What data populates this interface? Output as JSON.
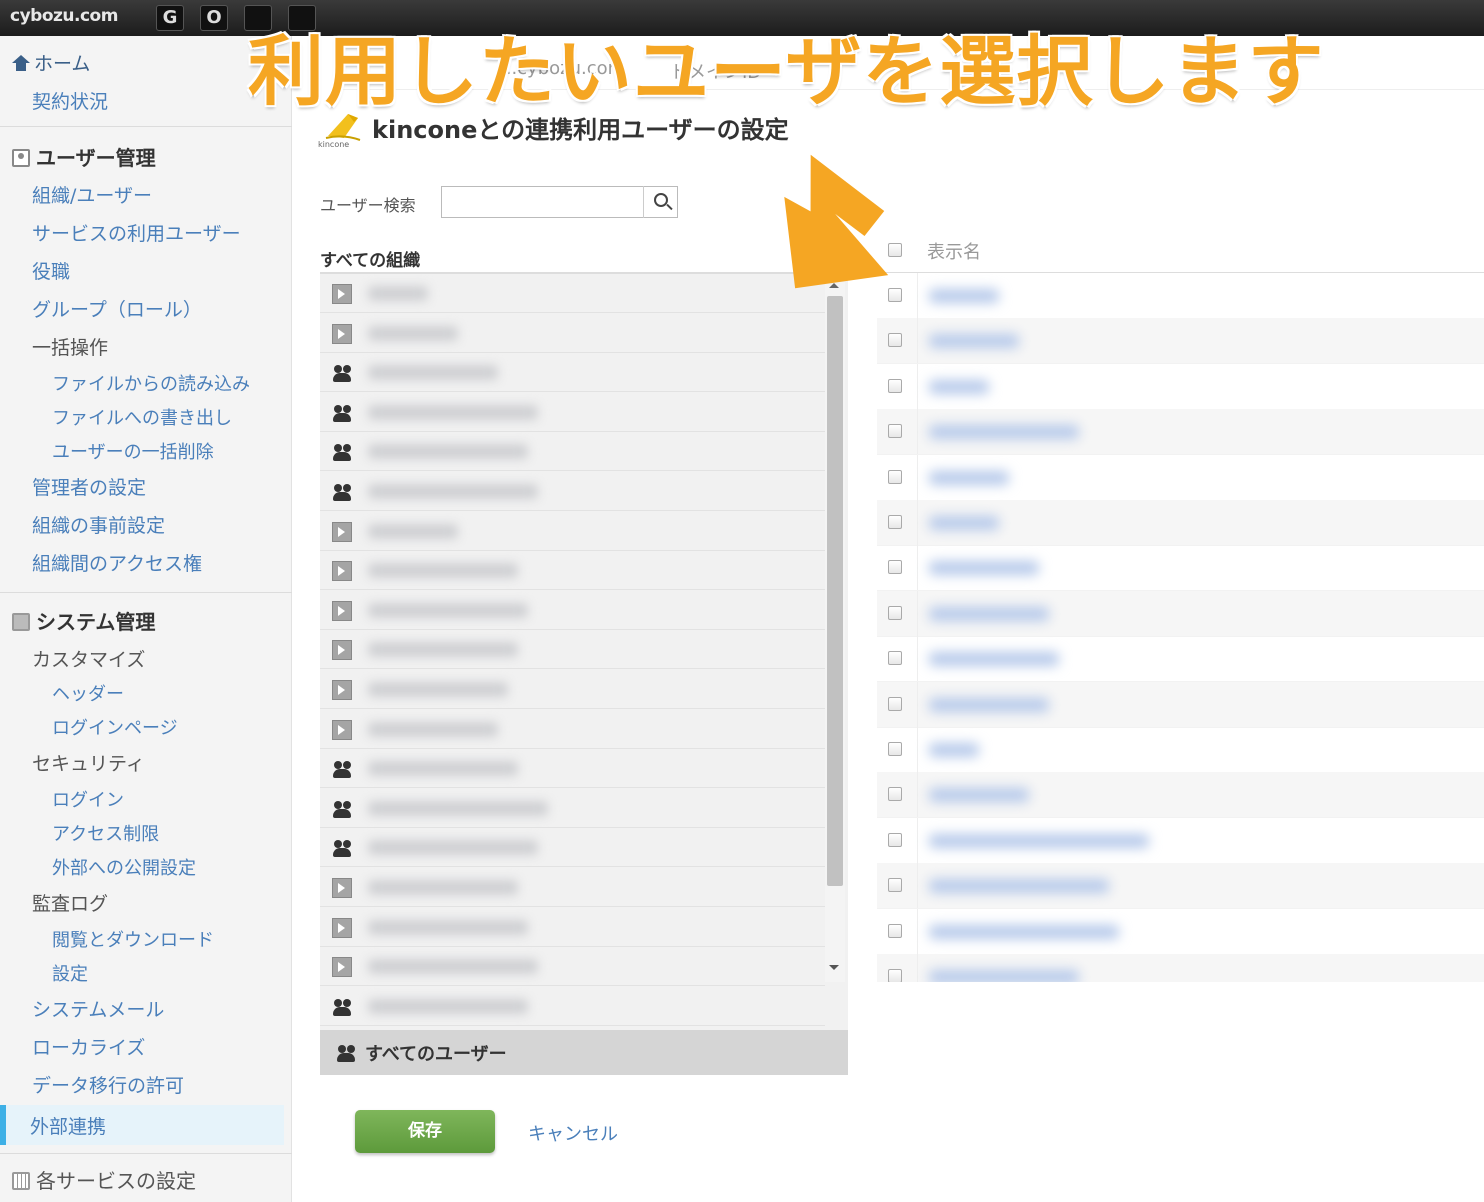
{
  "topbar": {
    "brand": "cybozu.com",
    "icons": [
      {
        "name": "garoon-icon",
        "glyph": "G"
      },
      {
        "name": "office-icon",
        "glyph": "O"
      },
      {
        "name": "app-icon-3",
        "glyph": ""
      },
      {
        "name": "app-icon-4",
        "glyph": ""
      }
    ]
  },
  "overlay": {
    "annotation": "利用したいユーザを選択します",
    "color": "#f5a623"
  },
  "breadcrumb": {
    "partial_1": "...cybozu.com",
    "partial_2": "ドメインID"
  },
  "sidebar": {
    "home": "ホーム",
    "contract": "契約状況",
    "user_mgmt": {
      "heading": "ユーザー管理",
      "items": [
        "組織/ユーザー",
        "サービスの利用ユーザー",
        "役職",
        "グループ（ロール）",
        "一括操作"
      ],
      "bulk_sub": [
        "ファイルからの読み込み",
        "ファイルへの書き出し",
        "ユーザーの一括削除"
      ],
      "items2": [
        "管理者の設定",
        "組織の事前設定",
        "組織間のアクセス権"
      ]
    },
    "system_mgmt": {
      "heading": "システム管理",
      "customize": "カスタマイズ",
      "customize_sub": [
        "ヘッダー",
        "ログインページ"
      ],
      "security": "セキュリティ",
      "security_sub": [
        "ログイン",
        "アクセス制限",
        "外部への公開設定"
      ],
      "audit": "監査ログ",
      "audit_sub": [
        "閲覧とダウンロード",
        "設定"
      ],
      "items": [
        "システムメール",
        "ローカライズ",
        "データ移行の許可"
      ],
      "active": "外部連携"
    },
    "services": {
      "heading": "各サービスの設定"
    }
  },
  "main": {
    "title": "kinconeとの連携利用ユーザーの設定",
    "logo_text": "kincone",
    "search_label": "ユーザー検索",
    "search_value": "",
    "org_heading": "すべての組織",
    "org_rows": [
      {
        "icon": "folder-icon"
      },
      {
        "icon": "folder-icon"
      },
      {
        "icon": "people-icon"
      },
      {
        "icon": "people-icon"
      },
      {
        "icon": "people-icon"
      },
      {
        "icon": "people-icon"
      },
      {
        "icon": "folder-icon"
      },
      {
        "icon": "folder-icon"
      },
      {
        "icon": "folder-icon"
      },
      {
        "icon": "folder-icon"
      },
      {
        "icon": "folder-icon"
      },
      {
        "icon": "folder-icon"
      },
      {
        "icon": "people-icon"
      },
      {
        "icon": "people-icon"
      },
      {
        "icon": "people-icon"
      },
      {
        "icon": "folder-icon"
      },
      {
        "icon": "folder-icon"
      },
      {
        "icon": "folder-icon"
      },
      {
        "icon": "people-icon"
      }
    ],
    "all_users": "すべてのユーザー",
    "user_table": {
      "header": "表示名",
      "row_count": 16
    },
    "save_label": "保存",
    "cancel_label": "キャンセル"
  }
}
